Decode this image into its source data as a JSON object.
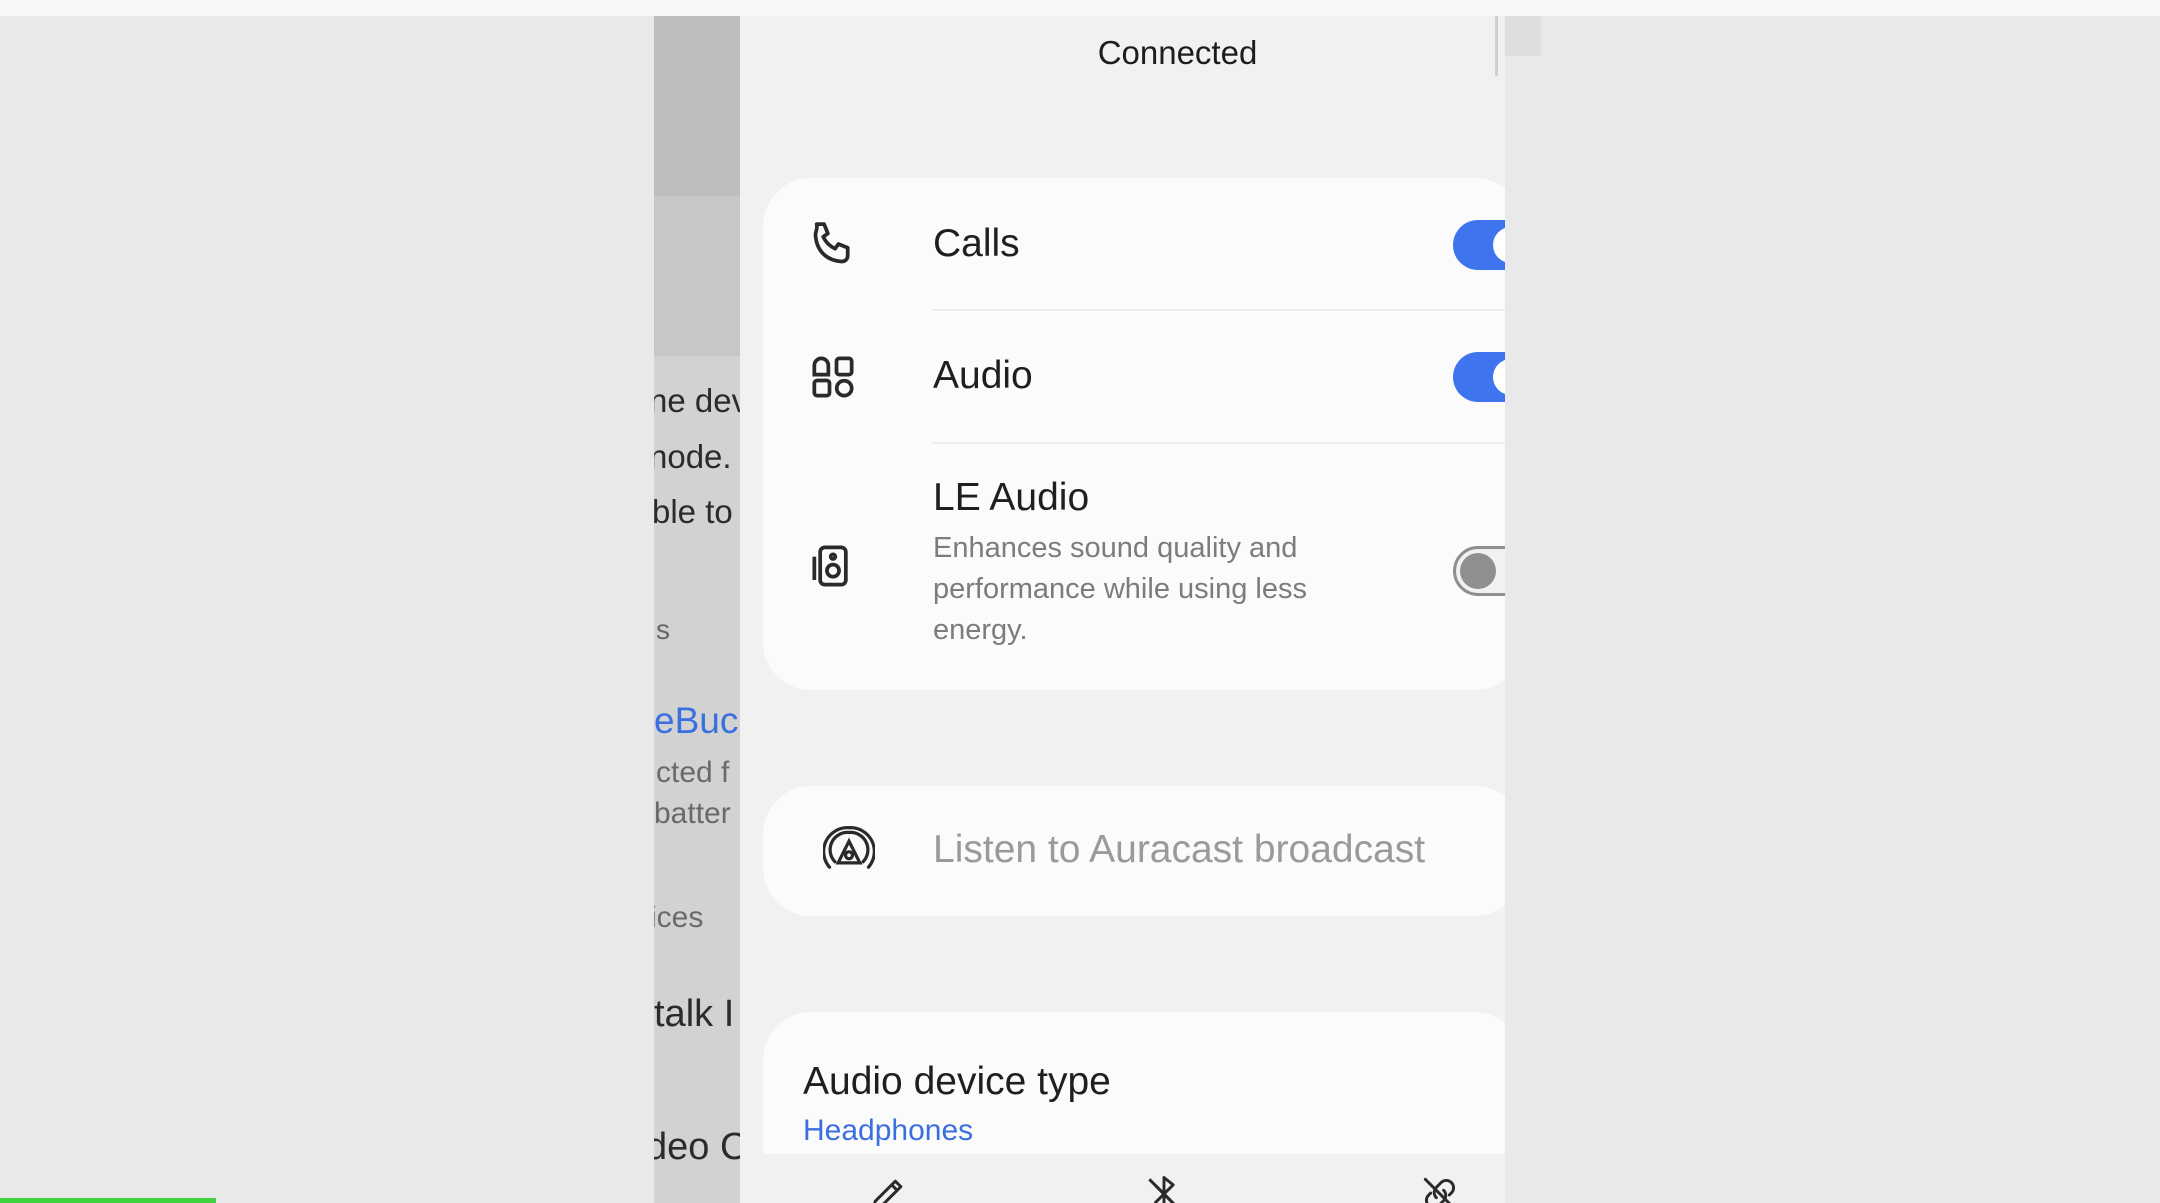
{
  "sheet": {
    "status": "Connected",
    "settings": [
      {
        "label": "Calls",
        "icon": "phone-icon",
        "enabled": true
      },
      {
        "label": "Audio",
        "icon": "apps-icon",
        "enabled": true
      },
      {
        "label": "LE Audio",
        "description": "Enhances sound quality and performance while using less energy.",
        "icon": "speaker-icon",
        "enabled": false
      }
    ],
    "auracast": {
      "label": "Listen to Auracast broadcast",
      "icon": "auracast-icon"
    },
    "device_type": {
      "title": "Audio device type",
      "value": "Headphones"
    },
    "bottom_actions": [
      {
        "icon": "pencil-icon"
      },
      {
        "icon": "bluetooth-off-icon"
      },
      {
        "icon": "unlink-icon"
      }
    ]
  },
  "background_fragments": [
    "ne dev",
    "node.",
    "ble to",
    "s",
    "eBuc",
    "cted f",
    "batter",
    "ices",
    "talk I",
    "deo C"
  ],
  "colors": {
    "accent": "#3e75ef",
    "link": "#3a6fe0",
    "sheet_bg": "#f1f1f1",
    "card_bg": "#fbfbfb"
  }
}
